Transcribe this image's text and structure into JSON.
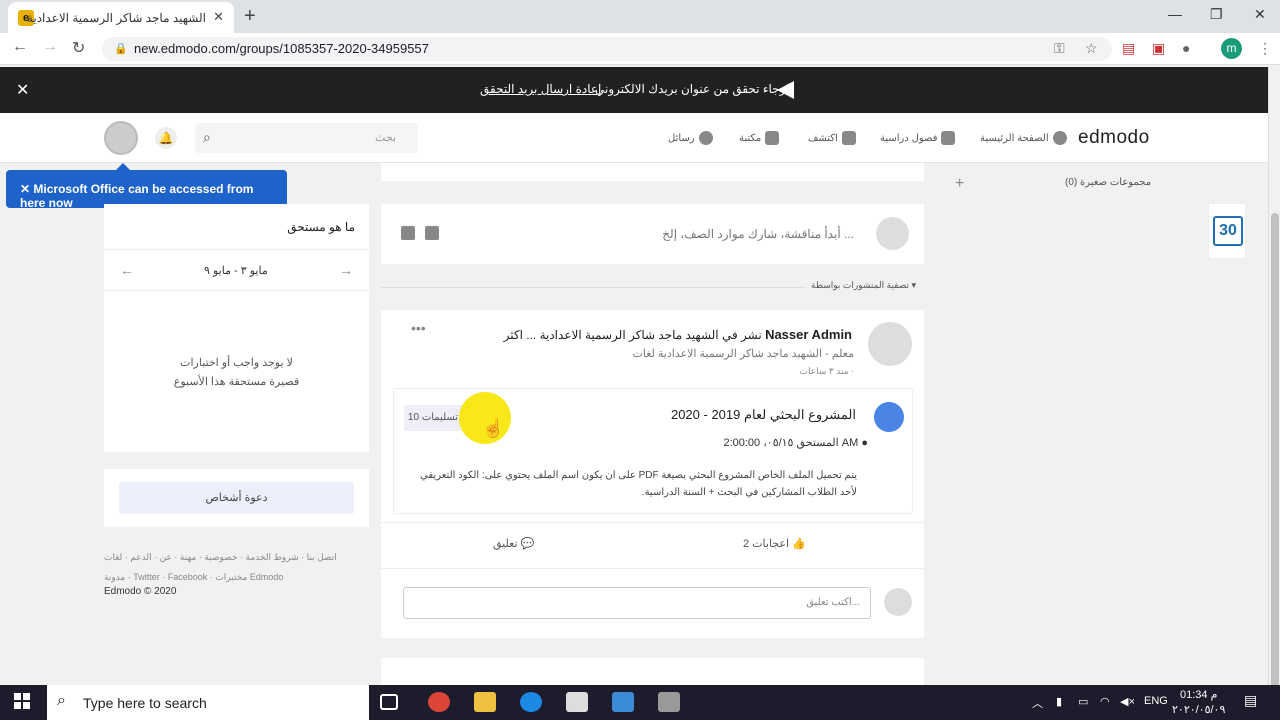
{
  "browser": {
    "tab_title": "الشهيد ماجد شاكر الرسمية الاعدادية",
    "url": "new.edmodo.com/groups/1085357-2020-34959557"
  },
  "banner": {
    "message": "الرجاء تحقق من عنوان بريدك الالكتروني",
    "link": "إعادة ارسال بريد التحقق"
  },
  "header": {
    "logo": "edmodo",
    "nav": [
      "الصفحة الرئيسية",
      "فصول دراسية",
      "اكتشف",
      "مكتبة",
      "رسائل"
    ],
    "search_placeholder": "بحث",
    "tooltip": "Microsoft Office can be accessed from here now"
  },
  "right_sidebar": {
    "small_groups": "مجموعات صغيرة (0)",
    "calendar_day": "30"
  },
  "compose": {
    "placeholder": "أبدأ مناقشة، شارك موارد الصف، إلخ ..."
  },
  "filter": {
    "label": "تصفية المنشورات بواسطة ▾"
  },
  "post": {
    "author": "Nasser Admin",
    "action": "نشر في الشهيد ماجد شاكر الرسمية الاعدادية ... اكثر",
    "subtitle": "معلم - الشهيد ماجد شاكر الرسمية الاعدادية لغات",
    "time": "منذ ٣ ساعات ·",
    "assignment": {
      "title": "المشروع البحثي لعام 2019 - 2020",
      "due": "المستحق ٠٥/١٥، 2:00:00 AM",
      "description": "يتم تحميل الملف الخاص المشروع البحثي بصيغة PDF على ان يكون اسم الملف يحتوي على: الكود التعريفي لأحد الطلاب المشاركين في البحث + السنة الدراسية.",
      "submissions": "10 تسليمات"
    },
    "likes": "2 اعجابات",
    "comment": "تعليق",
    "comment_placeholder": "اكتب تعليق..."
  },
  "left_sidebar": {
    "due_title": "ما هو مستحق",
    "date_range": "مايو ٣ - مايو ٩",
    "empty_text": [
      "لا يوجد واجب أو اختبارات",
      "قصيرة مستحقة هذا الأسبوع"
    ],
    "invite": "دعوة أشخاص",
    "footer_line1": "اتصل بنا · شروط الخدمة · خصوصية · مهنة · عن · الدعم · لغات",
    "footer_line2": "مدونة · Twitter · Facebook · مختبرات Edmodo",
    "copyright": "Edmodo © 2020"
  },
  "taskbar": {
    "search_placeholder": "Type here to search",
    "lang": "ENG",
    "time": "01:34 م",
    "date": "٢٠٢٠/٠٥/٠٩"
  },
  "colors": {
    "tooltip": "#1e63c9",
    "banner": "#212121",
    "highlight": "#f7e400"
  }
}
